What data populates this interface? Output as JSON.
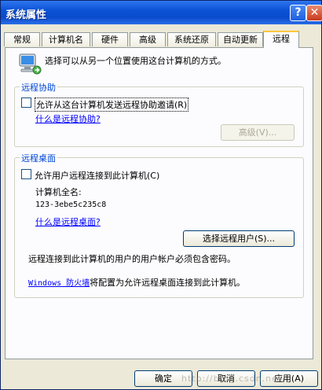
{
  "window": {
    "title": "系统属性",
    "help_glyph": "?",
    "close_glyph": "✕"
  },
  "tabs": [
    "常规",
    "计算机名",
    "硬件",
    "高级",
    "系统还原",
    "自动更新",
    "远程"
  ],
  "intro": "选择可以从另一个位置使用这台计算机的方式。",
  "remote_assistance": {
    "title": "远程协助",
    "checkbox_label": "允许从这台计算机发送远程协助邀请(R)",
    "checked": false,
    "help_link": "什么是远程协助?",
    "advanced_button": "高级(V)..."
  },
  "remote_desktop": {
    "title": "远程桌面",
    "checkbox_label": "允许用户远程连接到此计算机(C)",
    "checked": false,
    "computer_name_label": "计算机全名:",
    "computer_name": "123-3ebe5c235c8",
    "help_link": "什么是远程桌面?",
    "select_users_button": "选择远程用户(S)...",
    "password_note": "远程连接到此计算机的用户的用户帐户必须包含密码。",
    "firewall_link": "Windows 防火墙",
    "firewall_text": "将配置为允许远程桌面连接到此计算机。"
  },
  "footer": {
    "ok": "确定",
    "cancel": "取消",
    "apply": "应用(A)"
  },
  "watermark": "http://blog.csdn.net/",
  "colors": {
    "titlebar": "#0b53d6",
    "group_title": "#0046d5",
    "link": "#0000ff"
  }
}
